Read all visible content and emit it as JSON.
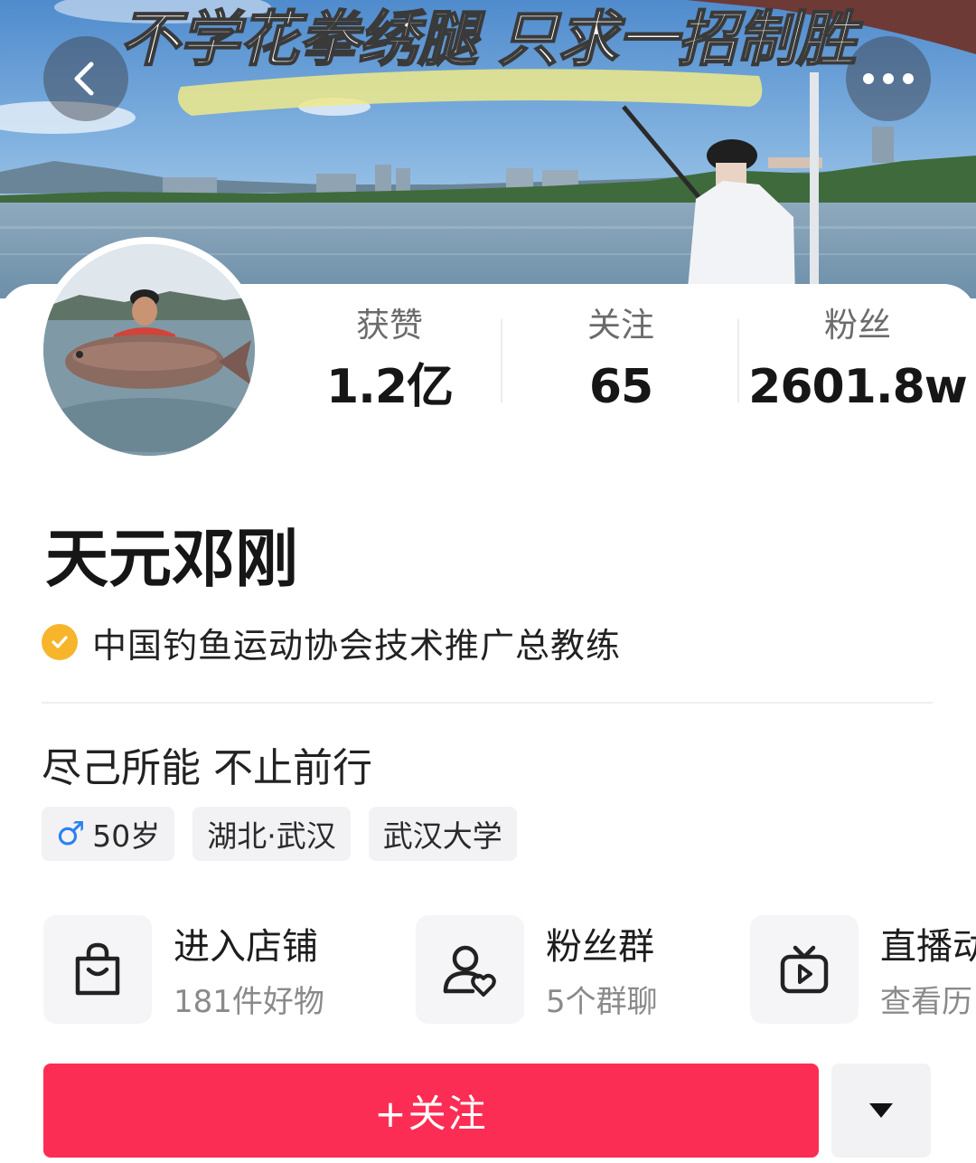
{
  "header": {
    "banner_text": "不学花拳绣腿  只求一招制胜",
    "back_icon": "chevron-left-icon",
    "more_icon": "more-horizontal-icon"
  },
  "stats": [
    {
      "label": "获赞",
      "value": "1.2亿"
    },
    {
      "label": "关注",
      "value": "65"
    },
    {
      "label": "粉丝",
      "value": "2601.8w"
    }
  ],
  "profile": {
    "name": "天元邓刚",
    "verification": "中国钓鱼运动协会技术推广总教练",
    "verification_icon": "verified-check-icon",
    "bio": "尽己所能 不止前行",
    "tags": {
      "gender_symbol": "♂",
      "age": "50岁",
      "location": "湖北·武汉",
      "school": "武汉大学"
    }
  },
  "shortcuts": [
    {
      "title": "进入店铺",
      "subtitle": "181件好物",
      "icon": "shopping-bag-icon"
    },
    {
      "title": "粉丝群",
      "subtitle": "5个群聊",
      "icon": "fan-group-icon"
    },
    {
      "title": "直播动",
      "subtitle": "查看历",
      "icon": "live-replay-icon"
    }
  ],
  "actions": {
    "follow_label": "+关注",
    "dropdown_icon": "caret-down-icon"
  },
  "colors": {
    "follow_button": "#fc2d55",
    "verify_badge": "#f7b52c",
    "gender_symbol": "#2a82f0"
  }
}
